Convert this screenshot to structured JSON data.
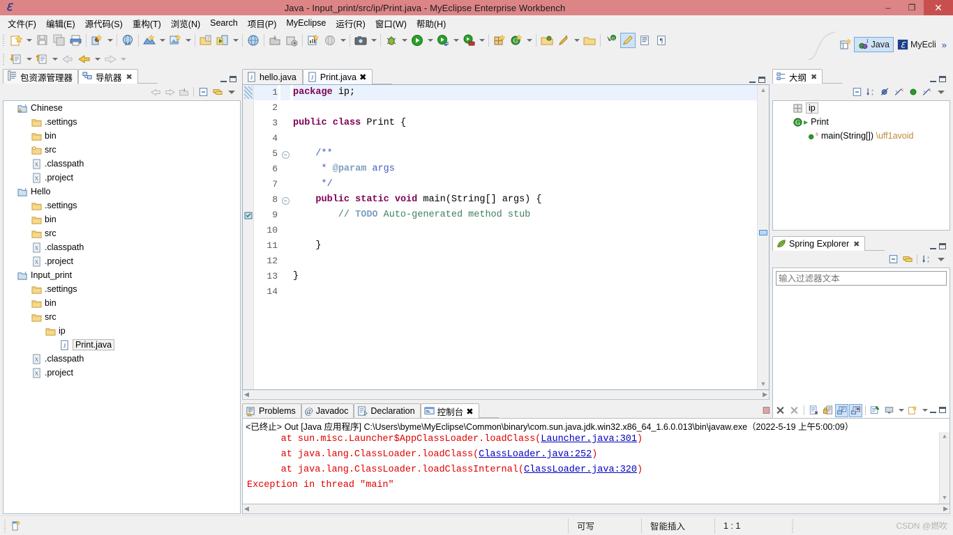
{
  "window": {
    "title": "Java  -  Input_print/src/ip/Print.java  -  MyEclipse Enterprise Workbench",
    "app_icon": "myeclipse-icon",
    "minimize": "–",
    "maximize": "❐",
    "close": "✕"
  },
  "menubar": {
    "items": [
      {
        "label": "文件(F)",
        "name": "menu-file"
      },
      {
        "label": "编辑(E)",
        "name": "menu-edit"
      },
      {
        "label": "源代码(S)",
        "name": "menu-source"
      },
      {
        "label": "重构(T)",
        "name": "menu-refactor"
      },
      {
        "label": "浏览(N)",
        "name": "menu-navigate"
      },
      {
        "label": "Search",
        "name": "menu-search"
      },
      {
        "label": "项目(P)",
        "name": "menu-project"
      },
      {
        "label": "MyEclipse",
        "name": "menu-myeclipse"
      },
      {
        "label": "运行(R)",
        "name": "menu-run"
      },
      {
        "label": "窗口(W)",
        "name": "menu-window"
      },
      {
        "label": "帮助(H)",
        "name": "menu-help"
      }
    ]
  },
  "perspective": {
    "open_perspective": "open-perspective-icon",
    "java_label": "Java",
    "myeclipse_label": "MyEcli",
    "chevron": "»"
  },
  "explorer": {
    "tabs": [
      {
        "label": "包资源管理器",
        "icon": "package-explorer-icon",
        "active": false,
        "closable": false
      },
      {
        "label": "导航器",
        "icon": "navigator-icon",
        "active": true,
        "closable": true
      }
    ],
    "tree": [
      {
        "label": "Chinese",
        "indent": 0,
        "icon": "java-project-warning-icon"
      },
      {
        "label": ".settings",
        "indent": 1,
        "icon": "folder-icon"
      },
      {
        "label": "bin",
        "indent": 1,
        "icon": "folder-icon"
      },
      {
        "label": "src",
        "indent": 1,
        "icon": "source-folder-icon"
      },
      {
        "label": ".classpath",
        "indent": 1,
        "icon": "xml-file-icon"
      },
      {
        "label": ".project",
        "indent": 1,
        "icon": "xml-file-icon"
      },
      {
        "label": "Hello",
        "indent": 0,
        "icon": "java-project-icon"
      },
      {
        "label": ".settings",
        "indent": 1,
        "icon": "folder-icon"
      },
      {
        "label": "bin",
        "indent": 1,
        "icon": "folder-icon"
      },
      {
        "label": "src",
        "indent": 1,
        "icon": "folder-icon"
      },
      {
        "label": ".classpath",
        "indent": 1,
        "icon": "xml-file-icon"
      },
      {
        "label": ".project",
        "indent": 1,
        "icon": "xml-file-icon"
      },
      {
        "label": "Input_print",
        "indent": 0,
        "icon": "java-project-icon"
      },
      {
        "label": ".settings",
        "indent": 1,
        "icon": "folder-icon"
      },
      {
        "label": "bin",
        "indent": 1,
        "icon": "folder-icon"
      },
      {
        "label": "src",
        "indent": 1,
        "icon": "folder-icon"
      },
      {
        "label": "ip",
        "indent": 2,
        "icon": "folder-icon"
      },
      {
        "label": "Print.java",
        "indent": 3,
        "icon": "java-file-icon",
        "selected": true
      },
      {
        "label": ".classpath",
        "indent": 1,
        "icon": "xml-file-icon"
      },
      {
        "label": ".project",
        "indent": 1,
        "icon": "xml-file-icon"
      }
    ]
  },
  "editor": {
    "tabs": [
      {
        "label": "hello.java",
        "icon": "java-file-icon",
        "active": false,
        "closable": false
      },
      {
        "label": "Print.java",
        "icon": "java-file-icon",
        "active": true,
        "closable": true
      }
    ],
    "lines": [
      {
        "n": "1",
        "fold": "",
        "highlight": true,
        "marker": "caret-marker",
        "tokens": [
          {
            "t": "package",
            "c": "kw"
          },
          {
            "t": " ip;",
            "c": "plain"
          }
        ]
      },
      {
        "n": "2",
        "fold": "",
        "tokens": []
      },
      {
        "n": "3",
        "fold": "",
        "tokens": [
          {
            "t": "public",
            "c": "kw"
          },
          {
            "t": " ",
            "c": "plain"
          },
          {
            "t": "class",
            "c": "kw"
          },
          {
            "t": " Print {",
            "c": "plain"
          }
        ]
      },
      {
        "n": "4",
        "fold": "",
        "tokens": []
      },
      {
        "n": "5",
        "fold": "minus",
        "tokens": [
          {
            "t": "    /**",
            "c": "jdoc"
          }
        ]
      },
      {
        "n": "6",
        "fold": "",
        "tokens": [
          {
            "t": "     * ",
            "c": "jdoc"
          },
          {
            "t": "@param",
            "c": "jtag"
          },
          {
            "t": " args",
            "c": "jdoc"
          }
        ]
      },
      {
        "n": "7",
        "fold": "",
        "tokens": [
          {
            "t": "     */",
            "c": "jdoc"
          }
        ]
      },
      {
        "n": "8",
        "fold": "minus",
        "tokens": [
          {
            "t": "    ",
            "c": "plain"
          },
          {
            "t": "public",
            "c": "kw"
          },
          {
            "t": " ",
            "c": "plain"
          },
          {
            "t": "static",
            "c": "kw"
          },
          {
            "t": " ",
            "c": "plain"
          },
          {
            "t": "void",
            "c": "kw"
          },
          {
            "t": " main(String[] args) {",
            "c": "plain"
          }
        ]
      },
      {
        "n": "9",
        "fold": "",
        "marker": "todo-marker",
        "tokens": [
          {
            "t": "        // ",
            "c": "cmt"
          },
          {
            "t": "TODO",
            "c": "todo"
          },
          {
            "t": " Auto-generated method stub",
            "c": "cmt"
          }
        ]
      },
      {
        "n": "10",
        "fold": "",
        "tokens": []
      },
      {
        "n": "11",
        "fold": "",
        "tokens": [
          {
            "t": "    }",
            "c": "plain"
          }
        ]
      },
      {
        "n": "12",
        "fold": "",
        "tokens": []
      },
      {
        "n": "13",
        "fold": "",
        "tokens": [
          {
            "t": "}",
            "c": "plain"
          }
        ]
      },
      {
        "n": "14",
        "fold": "",
        "tokens": []
      }
    ]
  },
  "outline": {
    "tab_label": "大纲",
    "tab_icon": "outline-icon",
    "items": [
      {
        "label": "ip",
        "indent": 0,
        "icon": "package-icon",
        "selected": true
      },
      {
        "label": "Print",
        "indent": 0,
        "icon": "class-icon"
      },
      {
        "label": "main(String[]) \\uff1avoid",
        "indent": 1,
        "icon": "method-public-static-icon"
      }
    ]
  },
  "spring": {
    "tab_label": "Spring Explorer",
    "tab_icon": "spring-leaf-icon",
    "filter_placeholder": "输入过滤器文本"
  },
  "console": {
    "tabs": [
      {
        "label": "Problems",
        "icon": "problems-icon",
        "active": false,
        "closable": false
      },
      {
        "label": "Javadoc",
        "icon": "javadoc-icon",
        "active": false,
        "closable": false
      },
      {
        "label": "Declaration",
        "icon": "declaration-icon",
        "active": false,
        "closable": false
      },
      {
        "label": "控制台",
        "icon": "console-icon",
        "active": true,
        "closable": true
      }
    ],
    "header": "<已终止> Out [Java 应用程序] C:\\Users\\byme\\MyEclipse\\Common\\binary\\com.sun.java.jdk.win32.x86_64_1.6.0.013\\bin\\javaw.exe（2022-5-19 上午5:00:09）",
    "output": [
      {
        "pre": "      at sun.misc.Launcher$AppClassLoader.loadClass(",
        "link": "Launcher.java:301",
        "post": ")"
      },
      {
        "pre": "      at java.lang.ClassLoader.loadClass(",
        "link": "ClassLoader.java:252",
        "post": ")"
      },
      {
        "pre": "      at java.lang.ClassLoader.loadClassInternal(",
        "link": "ClassLoader.java:320",
        "post": ")"
      },
      {
        "pre": "Exception in thread \"main\"",
        "link": "",
        "post": ""
      }
    ]
  },
  "statusbar": {
    "writable": "可写",
    "insert_mode": "智能插入",
    "position": "1 : 1",
    "watermark": "CSDN @燃吹"
  },
  "colors": {
    "titlebar": "#dc8486",
    "close_button": "#c7504f",
    "keyword": "#7f0055",
    "comment": "#3f7f5f",
    "javadoc": "#3f5fbf",
    "error_text": "#e00000",
    "link": "#0000c0",
    "selection": "#cde3f7"
  }
}
